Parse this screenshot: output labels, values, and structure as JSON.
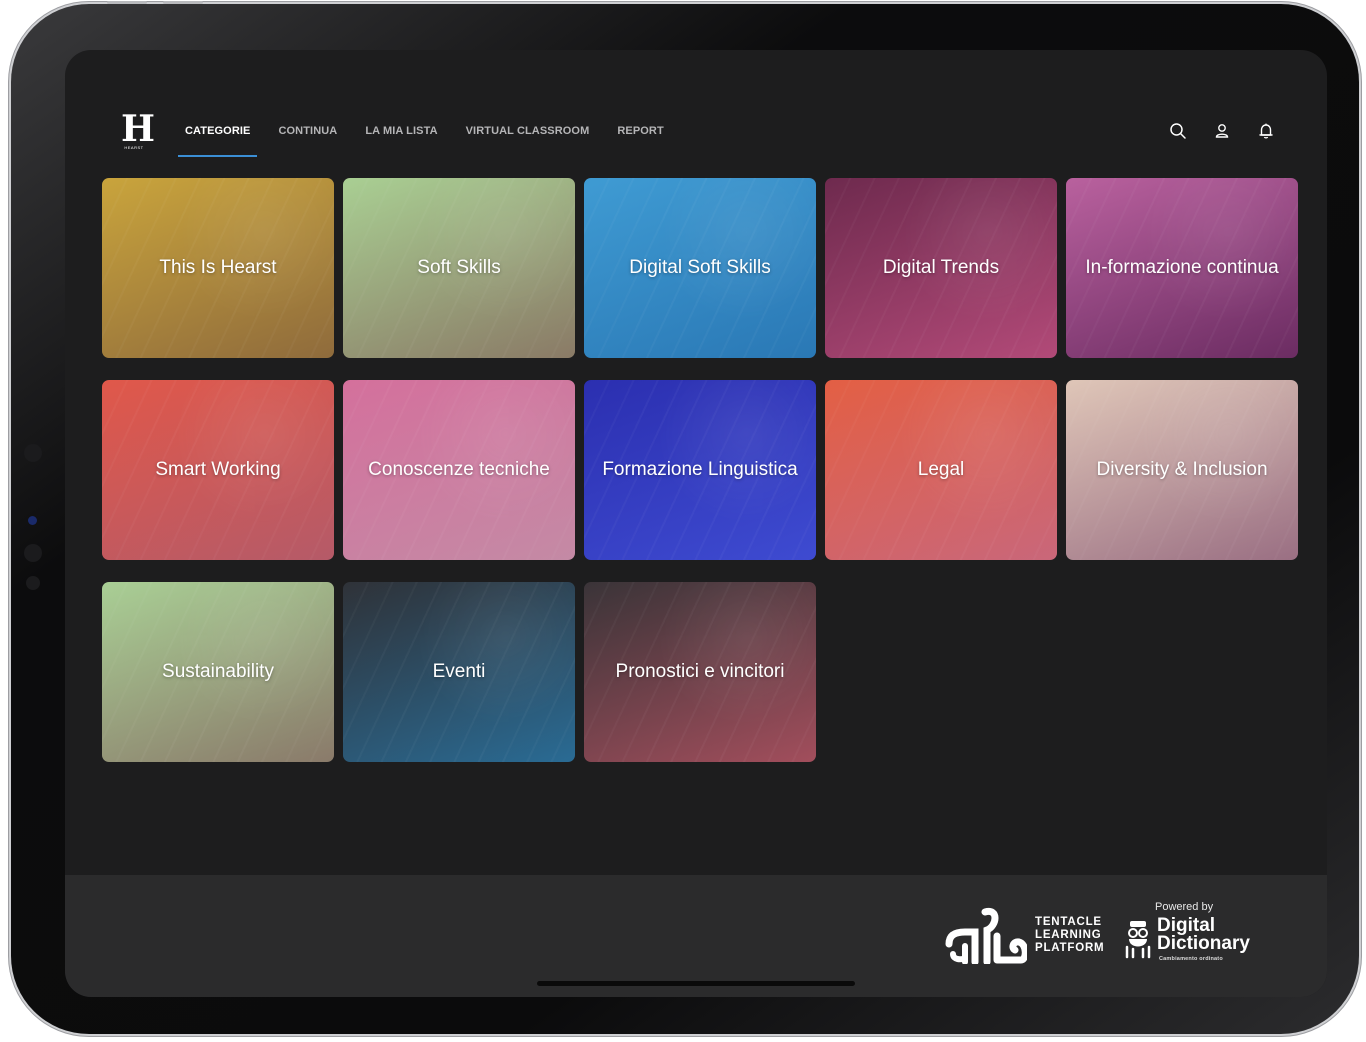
{
  "logo": {
    "letter": "H",
    "sub": "HEARST"
  },
  "nav": {
    "items": [
      {
        "label": "CATEGORIE",
        "active": true
      },
      {
        "label": "CONTINUA",
        "active": false
      },
      {
        "label": "LA MIA LISTA",
        "active": false
      },
      {
        "label": "VIRTUAL CLASSROOM",
        "active": false
      },
      {
        "label": "REPORT",
        "active": false
      }
    ],
    "accent_color": "#3b8fd6"
  },
  "header_icons": [
    "search-icon",
    "user-icon",
    "bell-icon"
  ],
  "categories": [
    {
      "label": "This Is Hearst",
      "colors": [
        "#c9a43c",
        "#8f6b3c"
      ]
    },
    {
      "label": "Soft Skills",
      "colors": [
        "#a9cf93",
        "#8a7a66"
      ]
    },
    {
      "label": "Digital Soft Skills",
      "colors": [
        "#3f9bd3",
        "#2a78b5"
      ]
    },
    {
      "label": "Digital Trends",
      "colors": [
        "#6e2a4e",
        "#b24a78"
      ]
    },
    {
      "label": "In-formazione continua",
      "colors": [
        "#b9619e",
        "#6b2c62"
      ]
    },
    {
      "label": "Smart Working",
      "colors": [
        "#e0584a",
        "#b55a68"
      ]
    },
    {
      "label": "Conoscenze tecniche",
      "colors": [
        "#d4709c",
        "#c48aa5"
      ]
    },
    {
      "label": "Formazione Linguistica",
      "colors": [
        "#2b2fb0",
        "#3e4bd1"
      ]
    },
    {
      "label": "Legal",
      "colors": [
        "#e35f44",
        "#c9677a"
      ]
    },
    {
      "label": "Diversity & Inclusion",
      "colors": [
        "#dfc6b8",
        "#9a6f83"
      ]
    },
    {
      "label": "Sustainability",
      "colors": [
        "#a9cf95",
        "#8a7a6a"
      ]
    },
    {
      "label": "Eventi",
      "colors": [
        "#2f3238",
        "#2a6b94"
      ]
    },
    {
      "label": "Pronostici e vincitori",
      "colors": [
        "#3a3438",
        "#a24e5c"
      ]
    }
  ],
  "footer": {
    "tlp_line1": "TENTACLE",
    "tlp_line2": "LEARNING",
    "tlp_line3": "PLATFORM",
    "powered_by": "Powered by",
    "dd_line1": "Digital",
    "dd_line2": "Dictionary",
    "dd_sub": "Cambiamento ordinato"
  }
}
